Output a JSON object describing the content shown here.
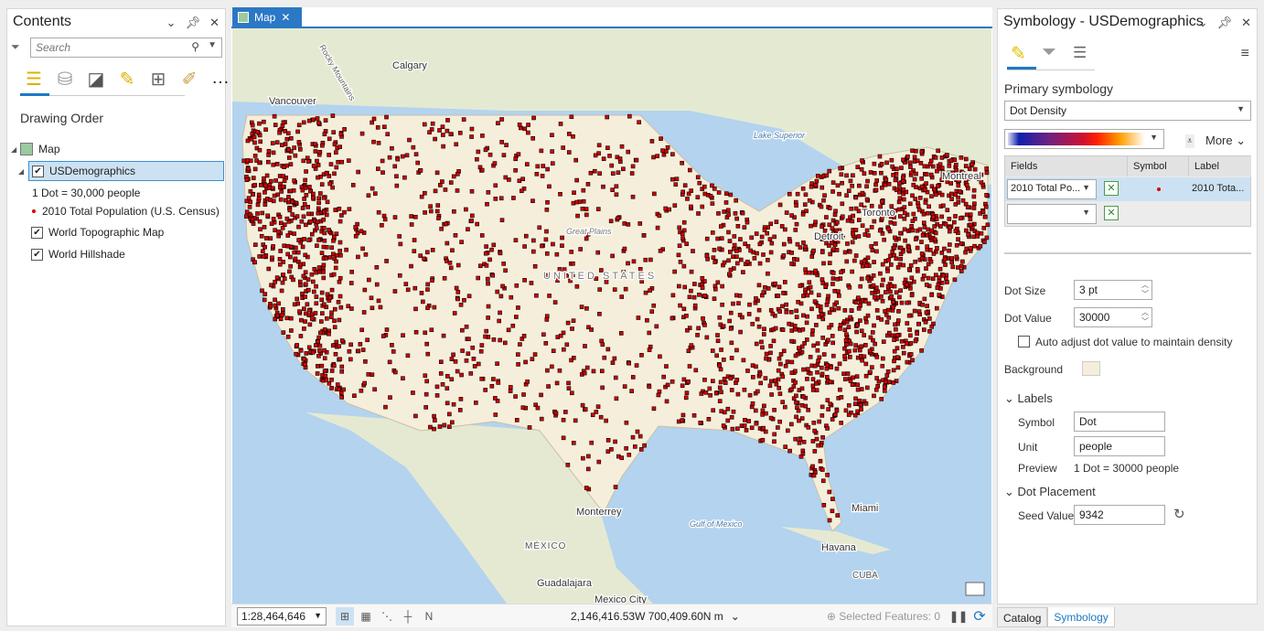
{
  "contents": {
    "title": "Contents",
    "search_placeholder": "Search",
    "heading": "Drawing Order",
    "map_label": "Map",
    "layer": "USDemographics",
    "dot_legend": "1 Dot = 30,000 people",
    "field_legend": "2010 Total Population (U.S. Census)",
    "basemaps": [
      "World Topographic Map",
      "World Hillshade"
    ]
  },
  "map": {
    "tab": "Map",
    "labels": {
      "calgary": "Calgary",
      "vancouver": "Vancouver",
      "rocky": "Rocky Mountains",
      "superior": "Lake Superior",
      "montreal": "Montreal",
      "toronto": "Toronto",
      "detroit": "Detroit",
      "plains": "Great Plains",
      "us": "UNITED STATES",
      "monterrey": "Monterrey",
      "gulf": "Gulf of Mexico",
      "mexico": "MÉXICO",
      "miami": "Miami",
      "havana": "Havana",
      "cuba": "CUBA",
      "guadalajara": "Guadalajara",
      "mexicocity": "Mexico City"
    },
    "colors": {
      "ocean": "#b3d3ef",
      "land": "#e8ecd8",
      "us": "#f5eedb",
      "dot": "#d40000"
    }
  },
  "status": {
    "scale": "1:28,464,646",
    "coords": "2,146,416.53W 700,409.60N m",
    "selected": "Selected Features: 0"
  },
  "symbology": {
    "title": "Symbology - USDemographics",
    "primary_label": "Primary symbology",
    "method": "Dot Density",
    "more": "More",
    "headers": {
      "fields": "Fields",
      "symbol": "Symbol",
      "label": "Label"
    },
    "row1": {
      "field": "2010 Total Po...",
      "label": "2010 Tota..."
    },
    "row2": {
      "field": ""
    },
    "dot_size_label": "Dot Size",
    "dot_size": "3 pt",
    "dot_value_label": "Dot Value",
    "dot_value": "30000",
    "auto_adjust": "Auto adjust dot value to maintain density",
    "auto_adjust_checked": false,
    "background_label": "Background",
    "background_color": "#f5eedb",
    "labels_section": "Labels",
    "symbol_label": "Symbol",
    "symbol_value": "Dot",
    "unit_label": "Unit",
    "unit_value": "people",
    "preview_label": "Preview",
    "preview_value": "1 Dot = 30000 people",
    "placement_section": "Dot Placement",
    "seed_label": "Seed Value",
    "seed_value": "9342"
  },
  "bottom_tabs": [
    "Catalog",
    "Symbology"
  ]
}
